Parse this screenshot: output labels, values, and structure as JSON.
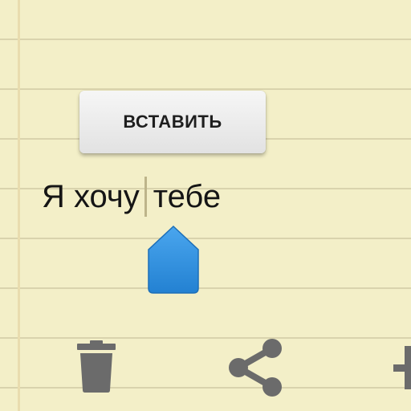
{
  "context_menu": {
    "paste_label": "ВСТАВИТЬ"
  },
  "note": {
    "text_before_cursor": "Я хочу",
    "text_after_cursor": "тебе"
  },
  "toolbar": {
    "icons": [
      "trash-icon",
      "share-icon",
      "add-icon"
    ]
  },
  "colors": {
    "paper": "#f3efc8",
    "rule_line": "#d9d3ad",
    "cursor_handle": "#2f8ddc",
    "toolbar_icon": "#6b6b6b"
  }
}
